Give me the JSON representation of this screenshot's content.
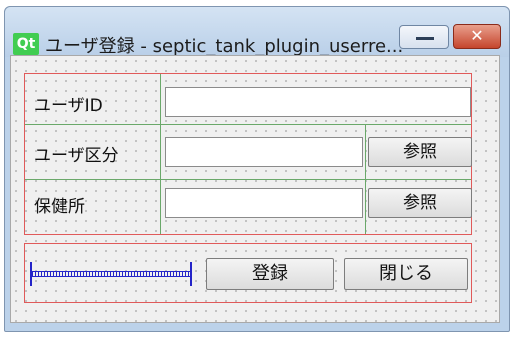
{
  "window": {
    "logo_text": "Qt",
    "title": "ユーザ登録 - septic_tank_plugin_userre...",
    "minimize_icon": "minimize-icon",
    "close_icon": "close-icon",
    "close_glyph": "✕"
  },
  "form": {
    "user_id": {
      "label": "ユーザID",
      "value": ""
    },
    "user_category": {
      "label": "ユーザ区分",
      "value": "",
      "browse_label": "参照"
    },
    "health_center": {
      "label": "保健所",
      "value": "",
      "browse_label": "参照"
    }
  },
  "actions": {
    "register_label": "登録",
    "close_label": "閉じる"
  },
  "colors": {
    "layout_outline": "#e05a5a",
    "grid_lines": "#6aa86a",
    "spacer": "#2424c8",
    "qt_green": "#41cd52"
  }
}
